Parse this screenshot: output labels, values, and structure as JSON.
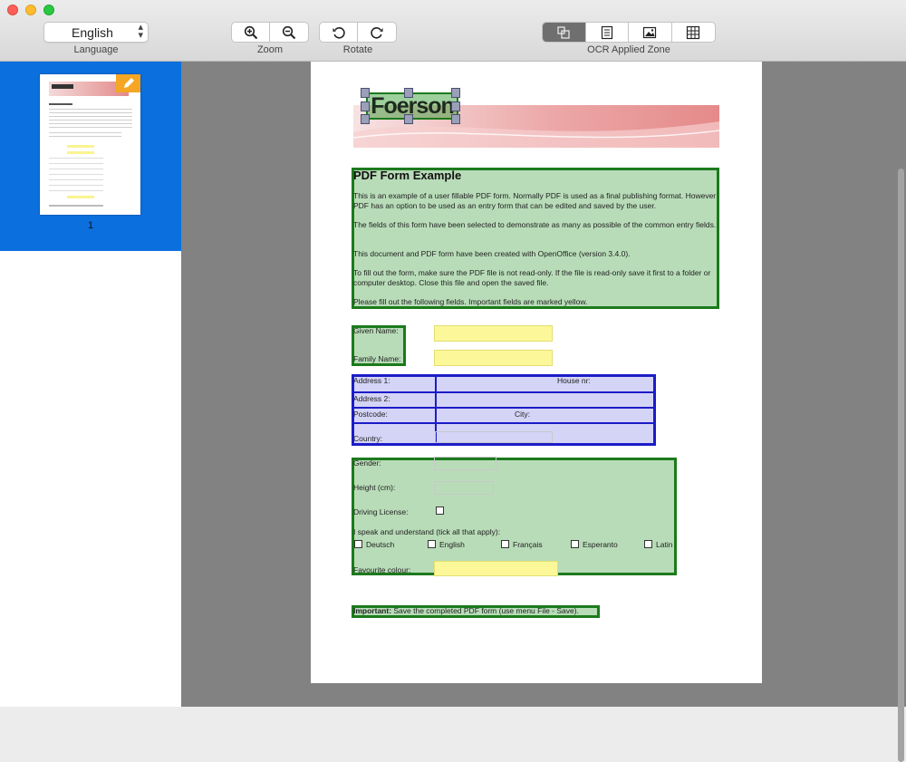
{
  "toolbar": {
    "language": {
      "label": "Language",
      "value": "English"
    },
    "zoom": {
      "label": "Zoom"
    },
    "rotate": {
      "label": "Rotate"
    },
    "ocr": {
      "label": "OCR Applied Zone"
    }
  },
  "sidebar": {
    "page_number": "1"
  },
  "document": {
    "logo_text": "Foerson",
    "title": "PDF Form Example",
    "paragraphs": [
      "This is an example of a user fillable PDF form. Normally PDF is used as a final publishing format. However PDF has an option to be used as an entry form that can be edited and saved by the user.",
      "The fields of this form have been selected to demonstrate as many as possible of the common entry fields.",
      "This document and PDF form have been created with OpenOffice (version 3.4.0).",
      "To fill out the form, make sure the PDF file is not read-only. If the file is read-only save it first to a folder or computer desktop. Close this file and open the saved file.",
      "Please fill out the following fields. Important fields are marked yellow."
    ],
    "labels": {
      "given_name": "Given Name:",
      "family_name": "Family Name:",
      "address1": "Address 1:",
      "house_nr": "House nr:",
      "address2": "Address 2:",
      "postcode": "Postcode:",
      "city": "City:",
      "country": "Country:",
      "gender": "Gender:",
      "height": "Height (cm):",
      "driving_license": "Driving License:",
      "languages": "I speak and understand (tick all that apply):",
      "favourite_colour": "Favourite colour:"
    },
    "language_options": [
      "Deutsch",
      "English",
      "Français",
      "Esperanto",
      "Latin"
    ],
    "important_bold": "Important:",
    "important_text": " Save the completed PDF form (use menu File - Save)."
  }
}
